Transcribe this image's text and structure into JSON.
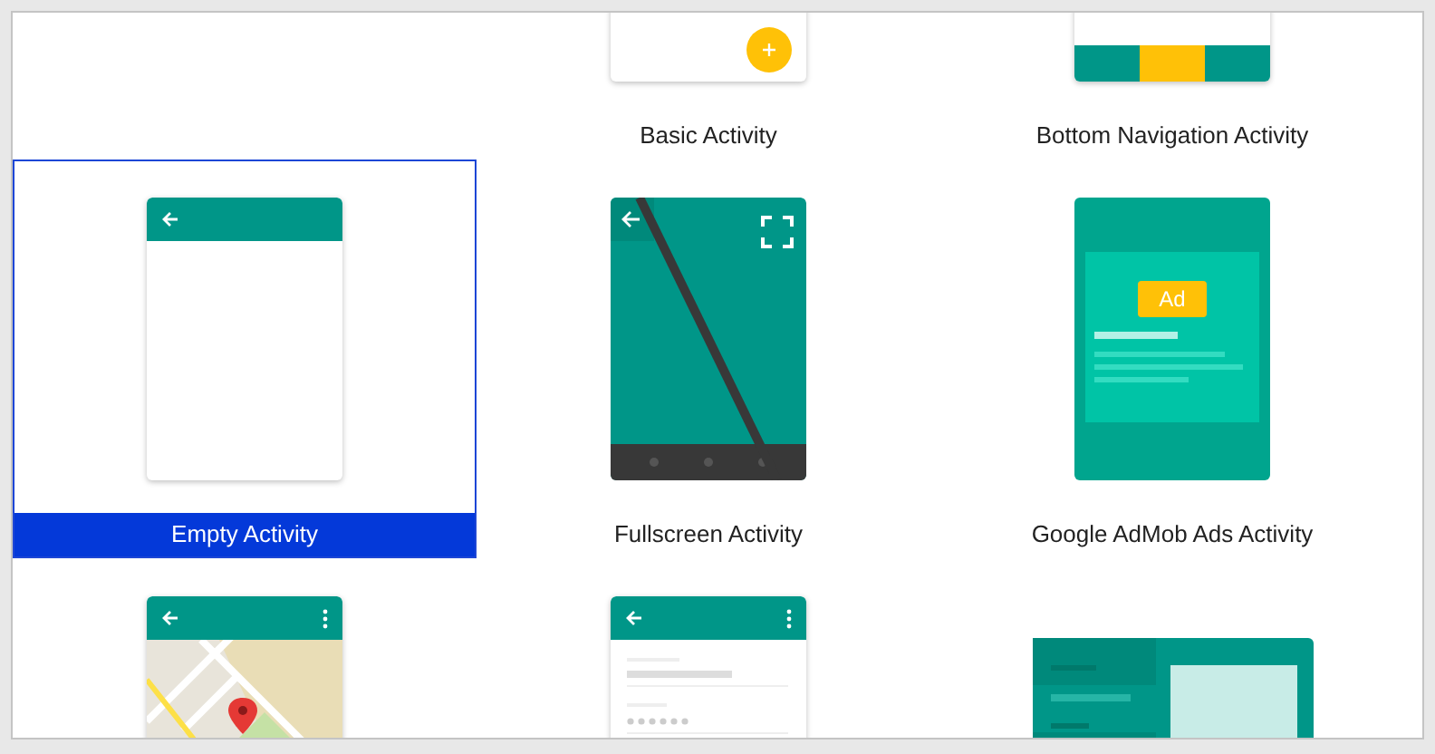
{
  "templates": [
    {
      "kind": "basic",
      "name": "Basic Activity",
      "selected": false
    },
    {
      "kind": "bottom_nav",
      "name": "Bottom Navigation Activity",
      "selected": false
    },
    {
      "kind": "empty",
      "name": "Empty Activity",
      "selected": true
    },
    {
      "kind": "fullscreen",
      "name": "Fullscreen Activity",
      "selected": false
    },
    {
      "kind": "admob",
      "name": "Google AdMob Ads Activity",
      "selected": false,
      "badge": "Ad"
    },
    {
      "kind": "map",
      "selected": false
    },
    {
      "kind": "login",
      "selected": false
    },
    {
      "kind": "master_detail",
      "selected": false
    }
  ]
}
